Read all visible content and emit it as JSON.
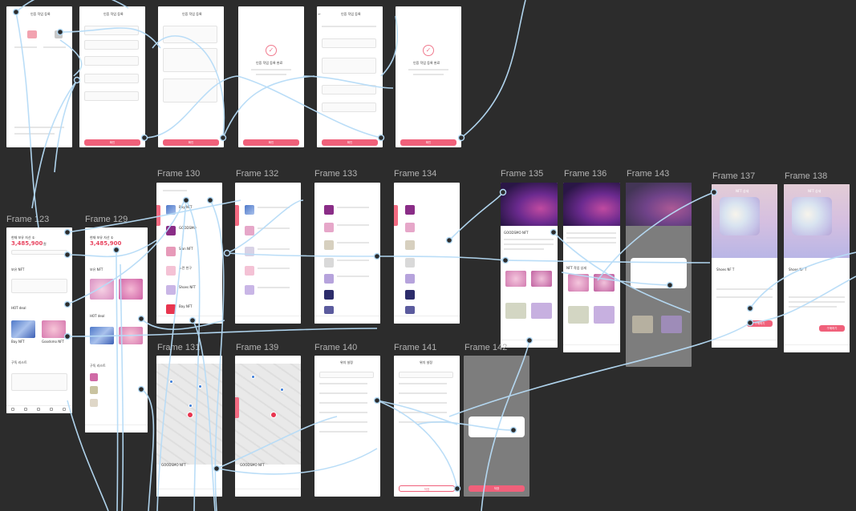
{
  "canvas": {
    "background": "#2c2c2c",
    "connector_color": "#b7dcf7",
    "accent": "#f0607a"
  },
  "labels": {
    "f130": "Frame 130",
    "f132": "Frame 132",
    "f133": "Frame 133",
    "f134": "Frame 134",
    "f135": "Frame 135",
    "f136": "Frame 136",
    "f143": "Frame 143",
    "f137": "Frame 137",
    "f138": "Frame 138",
    "f123": "Frame 123",
    "f129": "Frame 129",
    "f131": "Frame 131",
    "f139": "Frame 139",
    "f140": "Frame 140",
    "f141": "Frame 141",
    "f142": "Frame 142"
  },
  "top_row": {
    "f1_title": "인증 작업 등록",
    "f2_title": "인증 작업 등록",
    "f3_title": "인증 작업 등록",
    "f4_complete": "인증 작업 등록 완료",
    "f5_title": "인증 작업 등록",
    "f6_complete": "인증 작업 등록 완료",
    "confirm_button": "확인"
  },
  "home": {
    "balance_label": "현재 보유 자산 ①",
    "balance": "3,485,900",
    "unit": "원",
    "section_nft": "보유 NFT",
    "section_hot": "HOT deal",
    "section_sub": "구독 리스트",
    "nft1": "Bay NFT",
    "nft2": "Goodsmo NFT"
  },
  "market": {
    "list_items": [
      "Bay NFT",
      "GOODSMO",
      "Sian NFT",
      "노란 친구",
      "Shoes NFT",
      "Bay NFT"
    ]
  },
  "detail": {
    "title": "GOODSMO NFT",
    "related": "NFT 작업 상세",
    "product_title": "NFT 상세",
    "product_name": "Shoes NF T",
    "buy_button": "구매하기"
  },
  "map_screen": {
    "title": "GOODSMO NFT"
  },
  "settings": {
    "title": "위치 설정",
    "save_button": "저장"
  }
}
